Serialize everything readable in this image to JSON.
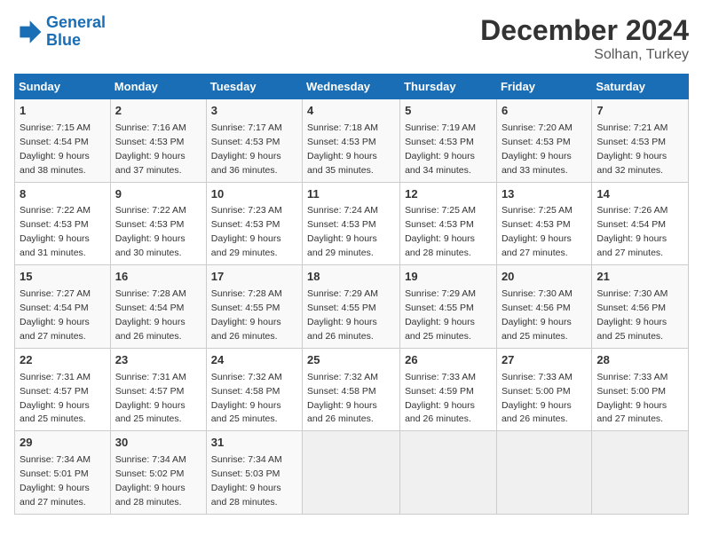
{
  "header": {
    "logo_line1": "General",
    "logo_line2": "Blue",
    "month_title": "December 2024",
    "location": "Solhan, Turkey"
  },
  "weekdays": [
    "Sunday",
    "Monday",
    "Tuesday",
    "Wednesday",
    "Thursday",
    "Friday",
    "Saturday"
  ],
  "weeks": [
    [
      {
        "day": "1",
        "sunrise": "7:15 AM",
        "sunset": "4:54 PM",
        "daylight": "9 hours and 38 minutes."
      },
      {
        "day": "2",
        "sunrise": "7:16 AM",
        "sunset": "4:53 PM",
        "daylight": "9 hours and 37 minutes."
      },
      {
        "day": "3",
        "sunrise": "7:17 AM",
        "sunset": "4:53 PM",
        "daylight": "9 hours and 36 minutes."
      },
      {
        "day": "4",
        "sunrise": "7:18 AM",
        "sunset": "4:53 PM",
        "daylight": "9 hours and 35 minutes."
      },
      {
        "day": "5",
        "sunrise": "7:19 AM",
        "sunset": "4:53 PM",
        "daylight": "9 hours and 34 minutes."
      },
      {
        "day": "6",
        "sunrise": "7:20 AM",
        "sunset": "4:53 PM",
        "daylight": "9 hours and 33 minutes."
      },
      {
        "day": "7",
        "sunrise": "7:21 AM",
        "sunset": "4:53 PM",
        "daylight": "9 hours and 32 minutes."
      }
    ],
    [
      {
        "day": "8",
        "sunrise": "7:22 AM",
        "sunset": "4:53 PM",
        "daylight": "9 hours and 31 minutes."
      },
      {
        "day": "9",
        "sunrise": "7:22 AM",
        "sunset": "4:53 PM",
        "daylight": "9 hours and 30 minutes."
      },
      {
        "day": "10",
        "sunrise": "7:23 AM",
        "sunset": "4:53 PM",
        "daylight": "9 hours and 29 minutes."
      },
      {
        "day": "11",
        "sunrise": "7:24 AM",
        "sunset": "4:53 PM",
        "daylight": "9 hours and 29 minutes."
      },
      {
        "day": "12",
        "sunrise": "7:25 AM",
        "sunset": "4:53 PM",
        "daylight": "9 hours and 28 minutes."
      },
      {
        "day": "13",
        "sunrise": "7:25 AM",
        "sunset": "4:53 PM",
        "daylight": "9 hours and 27 minutes."
      },
      {
        "day": "14",
        "sunrise": "7:26 AM",
        "sunset": "4:54 PM",
        "daylight": "9 hours and 27 minutes."
      }
    ],
    [
      {
        "day": "15",
        "sunrise": "7:27 AM",
        "sunset": "4:54 PM",
        "daylight": "9 hours and 27 minutes."
      },
      {
        "day": "16",
        "sunrise": "7:28 AM",
        "sunset": "4:54 PM",
        "daylight": "9 hours and 26 minutes."
      },
      {
        "day": "17",
        "sunrise": "7:28 AM",
        "sunset": "4:55 PM",
        "daylight": "9 hours and 26 minutes."
      },
      {
        "day": "18",
        "sunrise": "7:29 AM",
        "sunset": "4:55 PM",
        "daylight": "9 hours and 26 minutes."
      },
      {
        "day": "19",
        "sunrise": "7:29 AM",
        "sunset": "4:55 PM",
        "daylight": "9 hours and 25 minutes."
      },
      {
        "day": "20",
        "sunrise": "7:30 AM",
        "sunset": "4:56 PM",
        "daylight": "9 hours and 25 minutes."
      },
      {
        "day": "21",
        "sunrise": "7:30 AM",
        "sunset": "4:56 PM",
        "daylight": "9 hours and 25 minutes."
      }
    ],
    [
      {
        "day": "22",
        "sunrise": "7:31 AM",
        "sunset": "4:57 PM",
        "daylight": "9 hours and 25 minutes."
      },
      {
        "day": "23",
        "sunrise": "7:31 AM",
        "sunset": "4:57 PM",
        "daylight": "9 hours and 25 minutes."
      },
      {
        "day": "24",
        "sunrise": "7:32 AM",
        "sunset": "4:58 PM",
        "daylight": "9 hours and 25 minutes."
      },
      {
        "day": "25",
        "sunrise": "7:32 AM",
        "sunset": "4:58 PM",
        "daylight": "9 hours and 26 minutes."
      },
      {
        "day": "26",
        "sunrise": "7:33 AM",
        "sunset": "4:59 PM",
        "daylight": "9 hours and 26 minutes."
      },
      {
        "day": "27",
        "sunrise": "7:33 AM",
        "sunset": "5:00 PM",
        "daylight": "9 hours and 26 minutes."
      },
      {
        "day": "28",
        "sunrise": "7:33 AM",
        "sunset": "5:00 PM",
        "daylight": "9 hours and 27 minutes."
      }
    ],
    [
      {
        "day": "29",
        "sunrise": "7:34 AM",
        "sunset": "5:01 PM",
        "daylight": "9 hours and 27 minutes."
      },
      {
        "day": "30",
        "sunrise": "7:34 AM",
        "sunset": "5:02 PM",
        "daylight": "9 hours and 28 minutes."
      },
      {
        "day": "31",
        "sunrise": "7:34 AM",
        "sunset": "5:03 PM",
        "daylight": "9 hours and 28 minutes."
      },
      null,
      null,
      null,
      null
    ]
  ]
}
